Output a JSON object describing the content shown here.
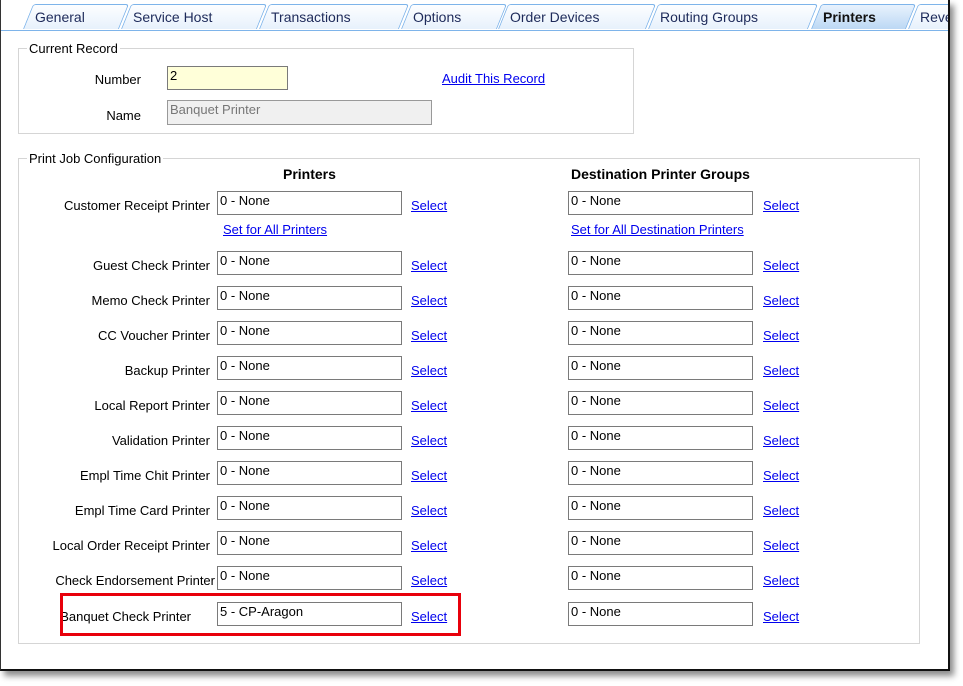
{
  "tabs": [
    {
      "label": "General",
      "selected": false
    },
    {
      "label": "Service Host",
      "selected": false
    },
    {
      "label": "Transactions",
      "selected": false
    },
    {
      "label": "Options",
      "selected": false
    },
    {
      "label": "Order Devices",
      "selected": false
    },
    {
      "label": "Routing Groups",
      "selected": false
    },
    {
      "label": "Printers",
      "selected": true
    },
    {
      "label": "Reve",
      "selected": false
    }
  ],
  "current_record": {
    "legend": "Current Record",
    "number_label": "Number",
    "number_value": "2",
    "name_label": "Name",
    "name_value": "Banquet Printer",
    "audit_link": "Audit This Record"
  },
  "print_job": {
    "legend": "Print Job Configuration",
    "printers_header": "Printers",
    "dest_header": "Destination Printer Groups",
    "set_all_printers": "Set for All Printers",
    "set_all_dest": "Set for All Destination Printers",
    "select_label": "Select",
    "rows": [
      {
        "label": "Customer Receipt Printer",
        "printer": "0 - None",
        "dest": "0 - None"
      },
      {
        "label": "Guest Check Printer",
        "printer": "0 - None",
        "dest": "0 - None"
      },
      {
        "label": "Memo Check Printer",
        "printer": "0 - None",
        "dest": "0 - None"
      },
      {
        "label": "CC Voucher Printer",
        "printer": "0 - None",
        "dest": "0 - None"
      },
      {
        "label": "Backup Printer",
        "printer": "0 - None",
        "dest": "0 - None"
      },
      {
        "label": "Local Report Printer",
        "printer": "0 - None",
        "dest": "0 - None"
      },
      {
        "label": "Validation Printer",
        "printer": "0 - None",
        "dest": "0 - None"
      },
      {
        "label": "Empl Time Chit Printer",
        "printer": "0 - None",
        "dest": "0 - None"
      },
      {
        "label": "Empl Time Card Printer",
        "printer": "0 - None",
        "dest": "0 - None"
      },
      {
        "label": "Local Order Receipt Printer",
        "printer": "0 - None",
        "dest": "0 - None"
      },
      {
        "label": "Check Endorsement Printer",
        "printer": "0 - None",
        "dest": "0 - None"
      },
      {
        "label": "Banquet Check Printer",
        "printer": "5 - CP-Aragon",
        "dest": "0 - None",
        "highlighted": true
      }
    ]
  },
  "colors": {
    "highlight": "#e8000b",
    "link": "#0000ee",
    "number_bg": "#ffffd9",
    "name_bg": "#f0f0f0"
  }
}
